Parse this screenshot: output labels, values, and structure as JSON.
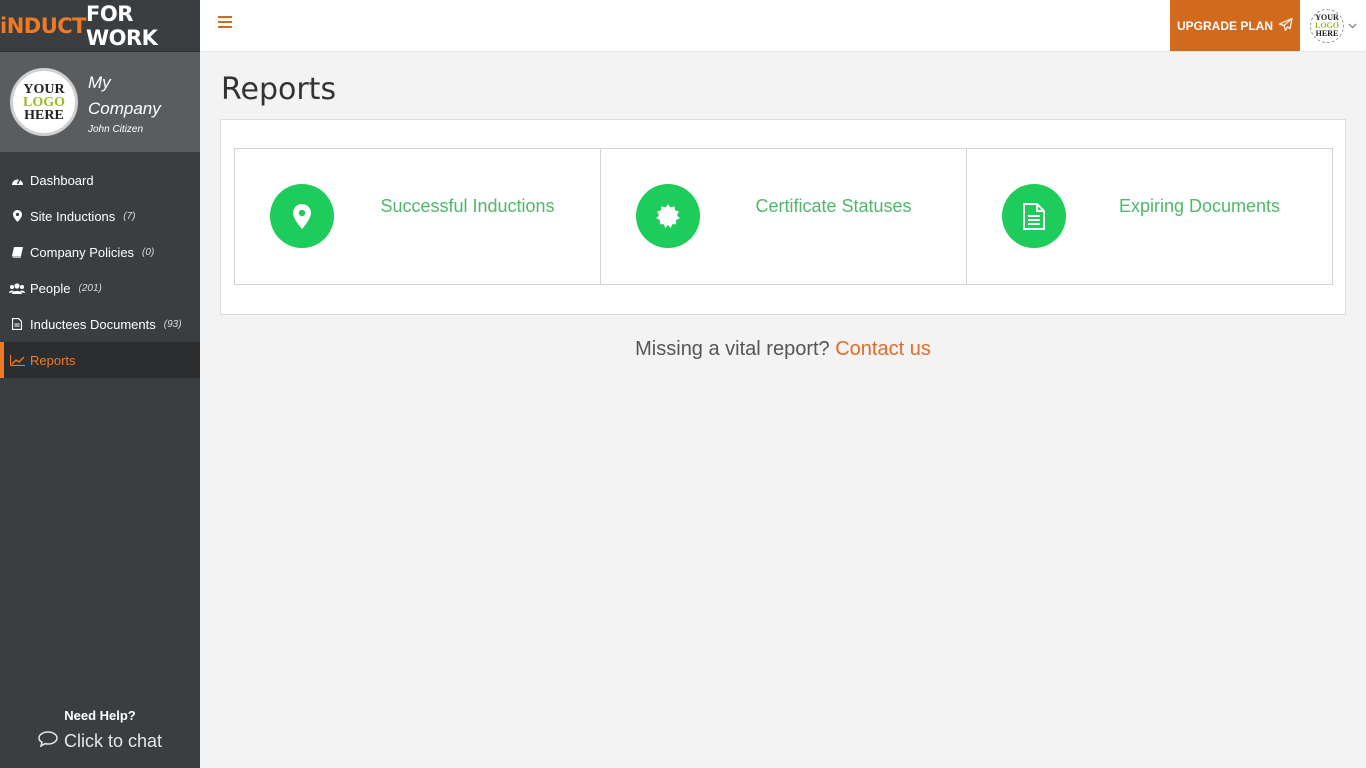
{
  "brand": {
    "part1": "iNDUCT",
    "part2": "FOR WORK"
  },
  "profile": {
    "logo_lines": [
      "YOUR",
      "LOGO",
      "HERE"
    ],
    "company": "My Company",
    "user": "John Citizen"
  },
  "sidebar": {
    "items": [
      {
        "label": "Dashboard",
        "count": "",
        "icon": "dashboard-icon"
      },
      {
        "label": "Site Inductions",
        "count": "(7)",
        "icon": "map-marker-icon"
      },
      {
        "label": "Company Policies",
        "count": "(0)",
        "icon": "book-icon"
      },
      {
        "label": "People",
        "count": "(201)",
        "icon": "users-icon"
      },
      {
        "label": "Inductees Documents",
        "count": "(93)",
        "icon": "document-icon"
      },
      {
        "label": "Reports",
        "count": "",
        "icon": "chart-line-icon",
        "active": true
      }
    ],
    "help_title": "Need Help?",
    "chat_label": "Click to chat"
  },
  "topbar": {
    "upgrade_label": "UPGRADE PLAN",
    "avatar_lines": [
      "YOUR",
      "LOGO",
      "HERE"
    ]
  },
  "main": {
    "title": "Reports",
    "cards": [
      {
        "label": "Successful Inductions",
        "icon": "map-marker-icon"
      },
      {
        "label": "Certificate Statuses",
        "icon": "certificate-icon"
      },
      {
        "label": "Expiring Documents",
        "icon": "file-icon"
      }
    ],
    "missing_text": "Missing a vital report?",
    "contact_link": "Contact us"
  },
  "colors": {
    "accent": "#d26a1d",
    "sidebar_bg": "#3b3e40",
    "card_icon_bg": "#1ecc5b",
    "card_label": "#4fb86a"
  }
}
